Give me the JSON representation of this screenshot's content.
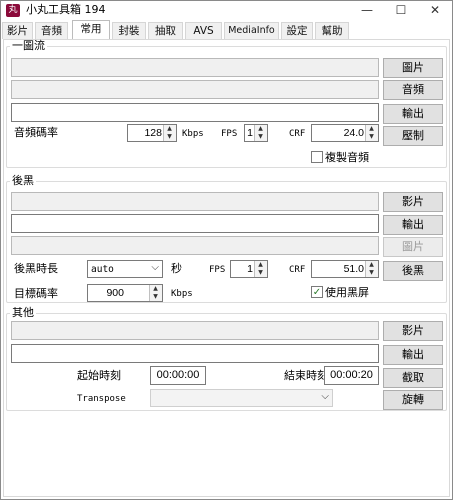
{
  "window": {
    "title": "小丸工具箱 194",
    "icon_glyph": "丸",
    "minimize": "—",
    "maximize": "☐",
    "close": "✕"
  },
  "tabs": [
    "影片",
    "音頻",
    "常用",
    "封裝",
    "抽取",
    "AVS",
    "MediaInfo",
    "設定",
    "幫助"
  ],
  "active_tab": "常用",
  "group1": {
    "title": "一圖流",
    "btn_video": "圖片",
    "btn_audio": "音頻",
    "btn_output": "輸出",
    "bitrate_label": "音頻碼率",
    "bitrate_value": "128",
    "bitrate_unit": "Kbps",
    "fps_label": "FPS",
    "fps_value": "1",
    "crf_label": "CRF",
    "crf_value": "24.0",
    "btn_run": "壓制",
    "copy_audio_label": "複製音頻",
    "copy_audio_checked": false
  },
  "group2": {
    "title": "後黑",
    "btn_video": "影片",
    "btn_output": "輸出",
    "btn_image": "圖片",
    "duration_label": "後黑時長",
    "duration_value": "auto",
    "duration_unit": "秒",
    "fps_label": "FPS",
    "fps_value": "1",
    "crf_label": "CRF",
    "crf_value": "51.0",
    "btn_run": "後黑",
    "target_bitrate_label": "目標碼率",
    "target_bitrate_value": "900",
    "target_bitrate_unit": "Kbps",
    "use_black_label": "使用黑屏",
    "use_black_checked": true
  },
  "group3": {
    "title": "其他",
    "btn_video": "影片",
    "btn_output": "輸出",
    "start_label": "起始時刻",
    "start_value": "00:00:00",
    "end_label": "結束時刻",
    "end_value": "00:00:20",
    "btn_cut": "截取",
    "transpose_label": "Transpose",
    "transpose_value": "",
    "btn_rotate": "旋轉"
  },
  "icons": {
    "spin_up": "▲",
    "spin_down": "▼",
    "caret": "⌵",
    "check": "✓"
  },
  "colors": {
    "app_icon": "#8b0a3a",
    "check": "#2a7a2a"
  }
}
